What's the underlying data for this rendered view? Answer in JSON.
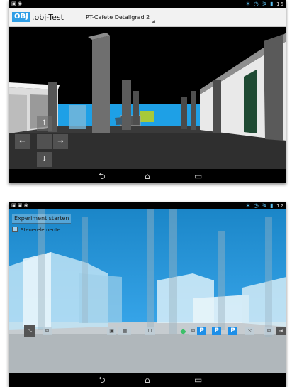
{
  "screen1": {
    "status_bar": {
      "left_icons": "▣ ◉",
      "right_icons": "✶ ◷ ⚞ ▮",
      "time": "16"
    },
    "action_bar": {
      "app_icon_label": "OBJ",
      "app_title": ".obj-Test",
      "selected_model": "PT-Cafete Detailgrad 2"
    },
    "dpad": {
      "up": "↑",
      "left": "←",
      "right": "→",
      "down": "↓"
    },
    "nav": {
      "back": "⮌",
      "home": "⌂",
      "recents": "▭"
    }
  },
  "screen2": {
    "status_bar": {
      "left_icons": "▣ ▣ ◉",
      "right_icons": "✶ ◷ ⚞ ▮",
      "time": "12"
    },
    "experiment_button": "Experiment starten",
    "controls_checkbox": "Steuerelemente",
    "nav": {
      "back": "⮌",
      "home": "⌂",
      "recents": "▭"
    }
  },
  "colors": {
    "accent": "#2f9ee6",
    "sky": "#1ea0e6",
    "parking": "#1d8fe8"
  }
}
